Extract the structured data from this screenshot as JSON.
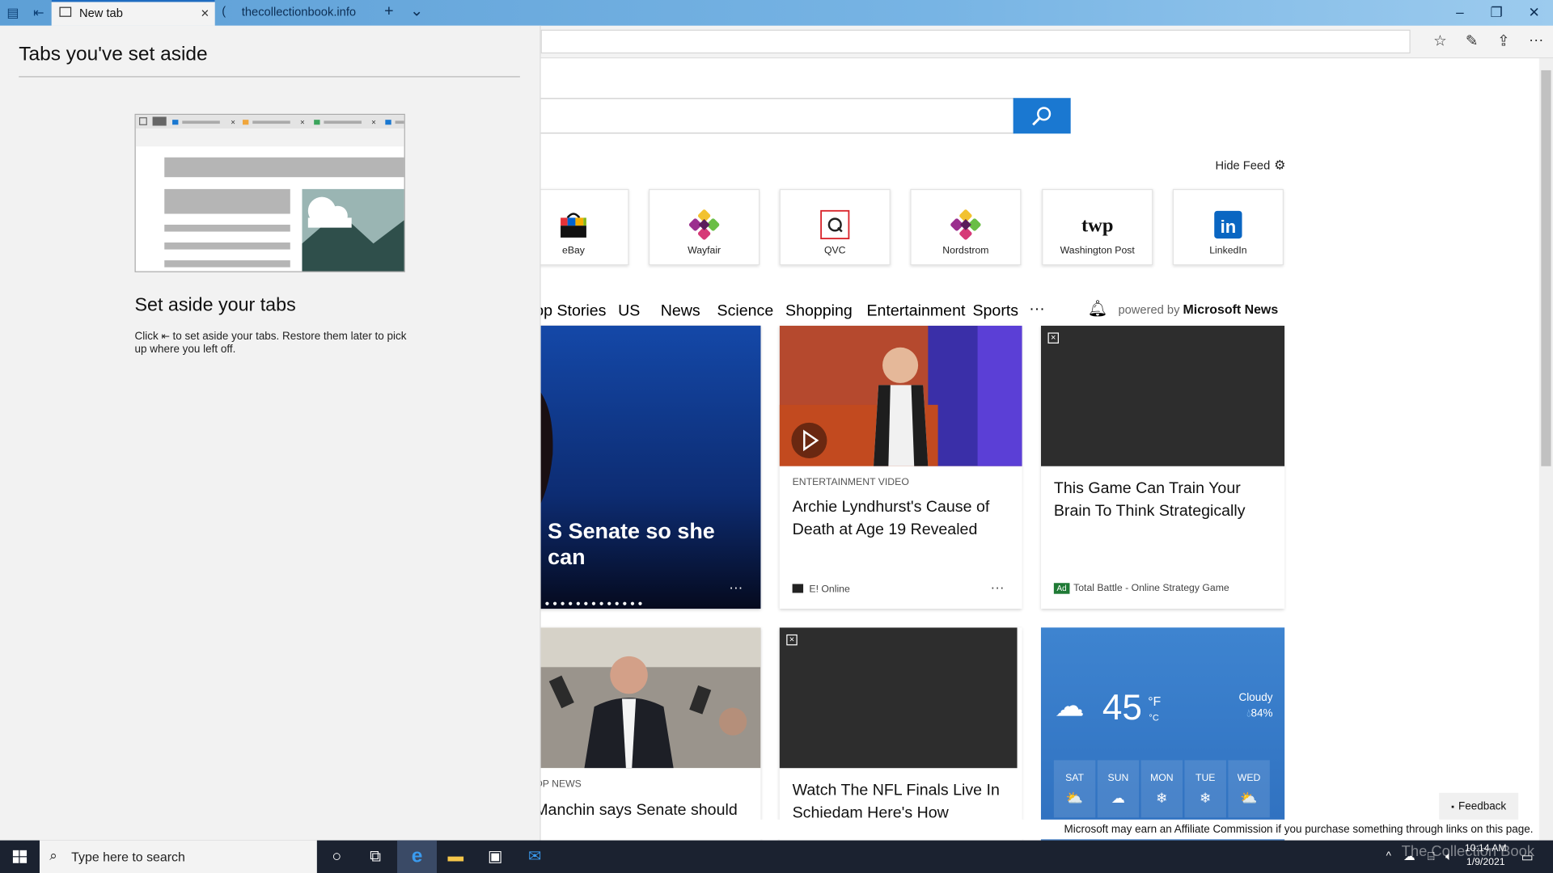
{
  "browser": {
    "tabs": [
      {
        "label": "New tab",
        "active": true
      },
      {
        "label": "thecollectionbook.info",
        "active": false
      }
    ],
    "new_tab_symbol": "+",
    "tab_list_symbol": "⌄",
    "close_tab_symbol": "×",
    "window_controls": [
      "–",
      "❐",
      "✕"
    ],
    "toolbar_icons": [
      "favorites-icon",
      "pen-icon",
      "share-icon",
      "more-icon"
    ]
  },
  "panel": {
    "title": "Tabs you've set aside",
    "heading": "Set aside your tabs",
    "text_before": "Click",
    "text_after": "to set aside your tabs. Restore them later to pick up where you left off."
  },
  "page": {
    "hide_feed_label": "Hide Feed",
    "top_sites": [
      {
        "label": "eBay",
        "color": "#e53238"
      },
      {
        "label": "Wayfair",
        "color": "#7f187f"
      },
      {
        "label": "QVC",
        "color": "#d9242b"
      },
      {
        "label": "Nordstrom",
        "color": "#7f187f"
      },
      {
        "label": "Washington Post",
        "color": "#111111"
      },
      {
        "label": "LinkedIn",
        "color": "#0a66c2"
      }
    ],
    "nav": [
      "op Stories",
      "US",
      "News",
      "Science",
      "Shopping",
      "Entertainment",
      "Sports",
      "···"
    ],
    "powered_prefix": "powered by",
    "powered_brand": "Microsoft News",
    "cards": {
      "lead_headline": "S Senate so she can",
      "archie": {
        "category": "ENTERTAINMENT VIDEO",
        "headline": "Archie Lyndhurst's Cause of Death at Age 19 Revealed",
        "source": "E! Online",
        "more": "···"
      },
      "ad1": {
        "headline": "This Game Can Train Your Brain To Think Strategically",
        "badge": "Ad",
        "source": "Total Battle - Online Strategy Game"
      },
      "manchin": {
        "category": "OP NEWS",
        "headline": "Manchin says Senate should"
      },
      "ad2": {
        "headline": "Watch The NFL Finals Live In Schiedam Here's How"
      },
      "lead_more": "···"
    },
    "weather": {
      "temp": "45",
      "unit_f": "°F",
      "unit_c": "°C",
      "condition": "Cloudy",
      "humidity": "84%",
      "days": [
        "SAT",
        "SUN",
        "MON",
        "TUE",
        "WED"
      ]
    },
    "feedback_label": "Feedback",
    "affiliate_text": "Microsoft may earn an Affiliate Commission if you purchase something through links on this page."
  },
  "taskbar": {
    "search_placeholder": "Type here to search",
    "time": "10:14 AM",
    "date": "1/9/2021",
    "watermark": "The Collection Book"
  }
}
